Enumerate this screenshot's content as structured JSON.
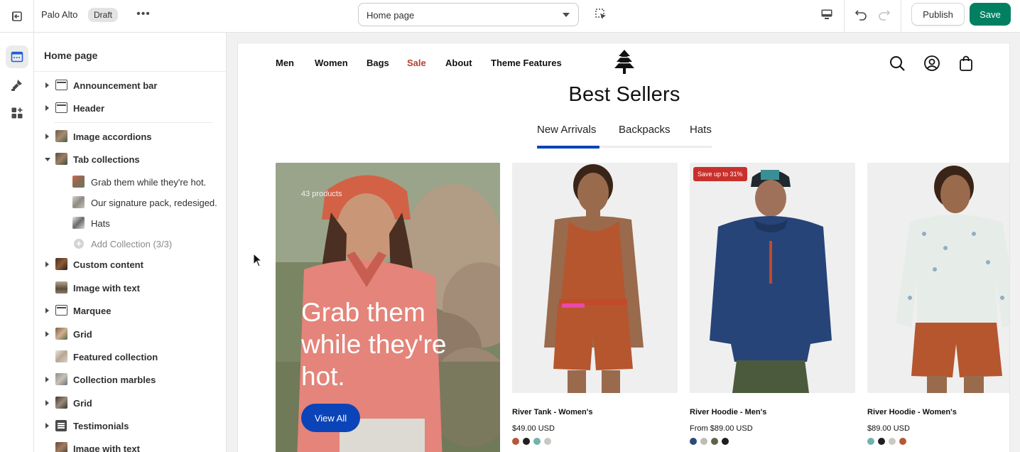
{
  "topbar": {
    "store_name": "Palo Alto",
    "status_badge": "Draft",
    "page_select": "Home page",
    "publish_label": "Publish",
    "save_label": "Save"
  },
  "sidebar": {
    "title": "Home page",
    "items": [
      {
        "label": "Announcement bar"
      },
      {
        "label": "Header"
      },
      {
        "label": "Image accordions"
      },
      {
        "label": "Tab collections"
      },
      {
        "label": "Grab them while they're hot."
      },
      {
        "label": "Our signature pack, redesiged."
      },
      {
        "label": "Hats"
      },
      {
        "label": "Add Collection (3/3)"
      },
      {
        "label": "Custom content"
      },
      {
        "label": "Image with text"
      },
      {
        "label": "Marquee"
      },
      {
        "label": "Grid"
      },
      {
        "label": "Featured collection"
      },
      {
        "label": "Collection marbles"
      },
      {
        "label": "Grid"
      },
      {
        "label": "Testimonials"
      },
      {
        "label": "Image with text"
      }
    ]
  },
  "preview": {
    "nav": [
      "Men",
      "Women",
      "Bags",
      "Sale",
      "About",
      "Theme Features"
    ],
    "section_title": "Best Sellers",
    "tabs": [
      "New Arrivals",
      "Backpacks",
      "Hats"
    ],
    "hero": {
      "count": "43 products",
      "heading": "Grab them while they're hot.",
      "button": "View All"
    },
    "products": [
      {
        "title": "River Tank - Women's",
        "price": "$49.00 USD",
        "badge": "",
        "swatches": [
          "#b55838",
          "#1f1f1f",
          "#6fb3ad",
          "#c9c9c4"
        ]
      },
      {
        "title": "River Hoodie - Men's",
        "price": "From $89.00 USD",
        "badge": "Save up to 31%",
        "swatches": [
          "#2d4a78",
          "#bdbdb5",
          "#5d6448",
          "#1f1f1f"
        ]
      },
      {
        "title": "River Hoodie - Women's",
        "price": "$89.00 USD",
        "badge": "",
        "swatches": [
          "#6fb3ad",
          "#1f1f1f",
          "#c9c9c4",
          "#b55838"
        ]
      }
    ]
  },
  "colors": {
    "save": "#008060",
    "accent_blue": "#0b44b8",
    "sale_red": "#b53f2e",
    "badge_red": "#c9302c"
  },
  "icons": [
    "exit-icon",
    "more-icon",
    "select-element-icon",
    "desktop-icon",
    "undo-icon",
    "redo-icon",
    "sections-icon",
    "theme-settings-icon",
    "apps-icon",
    "search-icon",
    "account-icon",
    "cart-icon",
    "tree-logo-icon"
  ]
}
